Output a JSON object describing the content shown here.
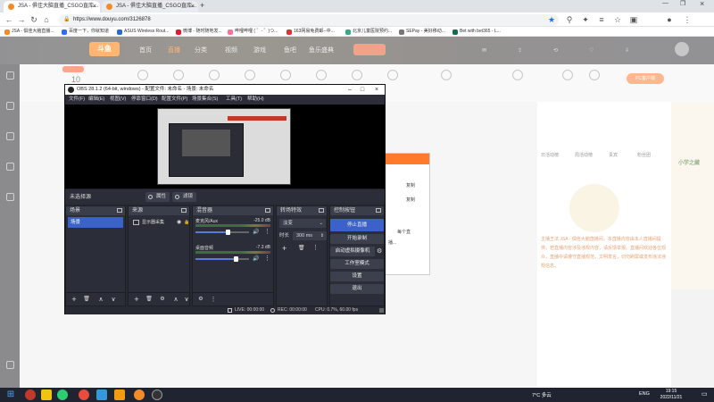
{
  "browser": {
    "tabs": [
      {
        "title": "JSA - 俱佳大脑直播_CSGO直库..."
      },
      {
        "title": "JSA - 俱佳大脑直播_CSGO直库..."
      }
    ],
    "url": "https://www.douyu.com/3126878",
    "bookmarks": [
      {
        "label": "JSA - 俱佳大脑直播...",
        "color": "#f28c28"
      },
      {
        "label": "百度一下，你就知道",
        "color": "#2f6bff"
      },
      {
        "label": "ASUS Wireless Rout...",
        "color": "#2a6ad2"
      },
      {
        "label": "微博 - 随时随地发...",
        "color": "#e6162d"
      },
      {
        "label": "哔哩哔哩 ( ゜- ゜)つ...",
        "color": "#fb7299"
      },
      {
        "label": "163网易免费邮--中...",
        "color": "#d33"
      },
      {
        "label": "北京儿童医院预约...",
        "color": "#3a8"
      },
      {
        "label": "SEPay - 美好移动...",
        "color": "#777"
      },
      {
        "label": "Bet with bet365 - L...",
        "color": "#126e51"
      }
    ]
  },
  "site": {
    "logo": "斗鱼",
    "nav": [
      "首页",
      "直播",
      "分类",
      "视频",
      "游戏",
      "鱼吧",
      "鱼乐盛典"
    ],
    "follow_count": "10",
    "live_badge": "PC客户端",
    "right_tabs": [
      "日活动榜",
      "周活动榜",
      "贵宾",
      "粉丝团"
    ],
    "notice": "主播王法 JSA - 俱佳大脑直播间，本直播内容由本人直播间提供，若直播内容涉及违规内容，请反馈举报。直播间欢迎各位观众，直播中请遵守直播规范，文明发言，切勿刷屏或发布违法违规信息。",
    "ad_title": "小学之藏"
  },
  "obs": {
    "title": "OBS 28.1.2 (64-bit, windows) - 配置文件: 未命名 - 场景: 未命名",
    "menu": [
      "文件(F)",
      "编辑(E)",
      "视图(V)",
      "停靠窗口(D)",
      "配置文件(P)",
      "场景集合(S)",
      "工具(T)",
      "帮助(H)"
    ],
    "no_source": "未选择源",
    "props_btn": "属性",
    "filters_btn": "滤镜",
    "docks": {
      "scenes": {
        "title": "场景",
        "items": [
          "场景"
        ]
      },
      "sources": {
        "title": "来源",
        "items": [
          "显示器采集"
        ]
      },
      "mixer": {
        "title": "混音器",
        "channels": [
          {
            "name": "麦克风/Aux",
            "db": "-25.0 dB",
            "level": 0.6
          },
          {
            "name": "桌面音频",
            "db": "-7.3 dB",
            "level": 0.75
          }
        ]
      },
      "transitions": {
        "title": "转场特效",
        "type": "淡变",
        "duration_label": "时长",
        "duration": "300 ms"
      },
      "controls": {
        "title": "控制按钮",
        "buttons": [
          "停止直播",
          "开始录制",
          "启动虚拟摄像机",
          "工作室模式",
          "设置",
          "退出"
        ]
      }
    },
    "status": {
      "live": "LIVE: 00:00:00",
      "rec": "REC: 00:00:00",
      "cpu": "CPU: 0.7%, 60.00 fps"
    }
  },
  "dialog": {
    "lines": [
      "复制",
      "复制",
      "每个直",
      "播..."
    ]
  },
  "taskbar": {
    "weather": "7°C 多云",
    "lang": "ENG",
    "time": "19:15",
    "date": "2022/11/21"
  }
}
